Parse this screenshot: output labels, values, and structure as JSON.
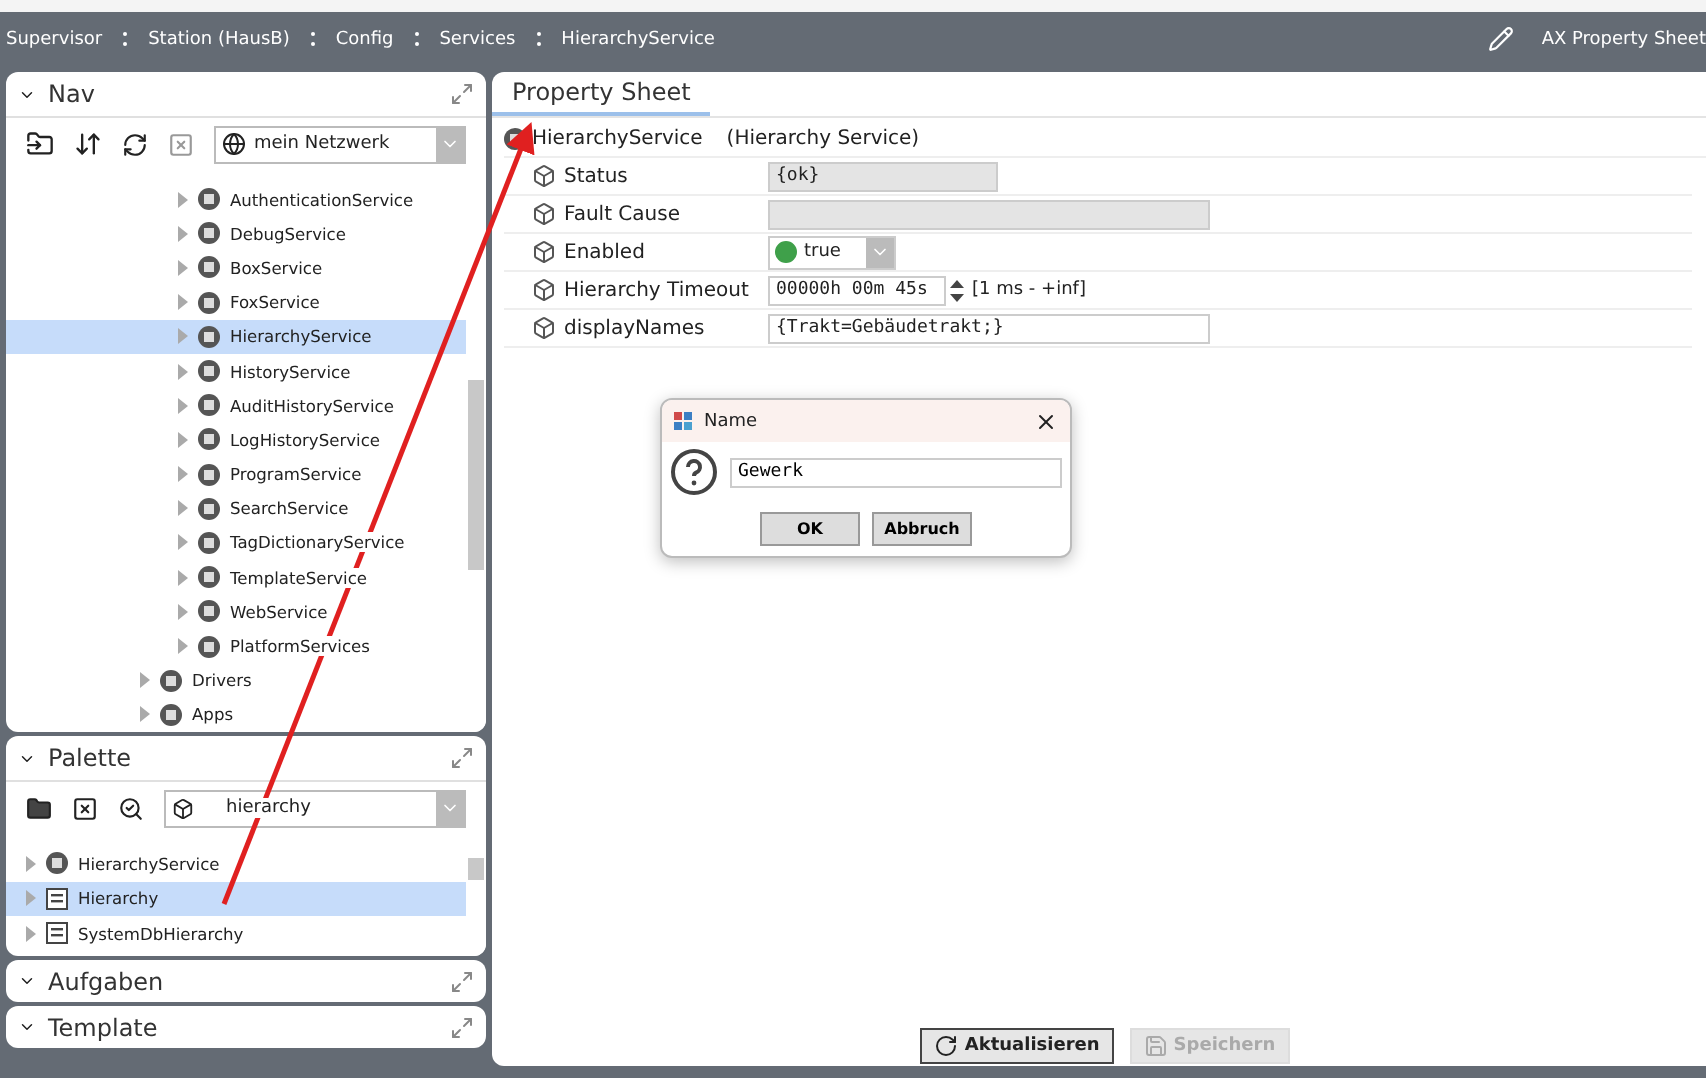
{
  "breadcrumb": [
    "Supervisor",
    "Station (HausB)",
    "Config",
    "Services",
    "HierarchyService"
  ],
  "view_name": "AX Property Sheet",
  "nav": {
    "title": "Nav",
    "network": "mein Netzwerk",
    "service_items": [
      {
        "label": "AuthenticationService",
        "selected": false
      },
      {
        "label": "DebugService",
        "selected": false
      },
      {
        "label": "BoxService",
        "selected": false
      },
      {
        "label": "FoxService",
        "selected": false
      },
      {
        "label": "HierarchyService",
        "selected": true
      },
      {
        "label": "HistoryService",
        "selected": false
      },
      {
        "label": "AuditHistoryService",
        "selected": false
      },
      {
        "label": "LogHistoryService",
        "selected": false
      },
      {
        "label": "ProgramService",
        "selected": false
      },
      {
        "label": "SearchService",
        "selected": false
      },
      {
        "label": "TagDictionaryService",
        "selected": false
      },
      {
        "label": "TemplateService",
        "selected": false
      },
      {
        "label": "WebService",
        "selected": false
      },
      {
        "label": "PlatformServices",
        "selected": false
      }
    ],
    "top_items": [
      {
        "label": "Drivers",
        "selected": false
      },
      {
        "label": "Apps",
        "selected": false
      }
    ]
  },
  "palette": {
    "title": "Palette",
    "filter": "hierarchy",
    "items": [
      {
        "label": "HierarchyService",
        "selected": false
      },
      {
        "label": "Hierarchy",
        "selected": true
      },
      {
        "label": "SystemDbHierarchy",
        "selected": false
      }
    ]
  },
  "collapsed_panels": [
    "Aufgaben",
    "Template"
  ],
  "tabs": [
    {
      "label": "Property Sheet",
      "selected": true
    }
  ],
  "sheet": {
    "component": "HierarchyService",
    "type": "(Hierarchy Service)",
    "properties": [
      {
        "name": "Status",
        "kind": "readonly",
        "value": "{ok}"
      },
      {
        "name": "Fault Cause",
        "kind": "readonly_wide"
      },
      {
        "name": "Enabled",
        "kind": "boolean",
        "value": "true"
      },
      {
        "name": "Hierarchy Timeout",
        "kind": "duration",
        "value": "00000h 00m 45s",
        "range": "[1 ms - +inf]"
      },
      {
        "name": "displayNames",
        "kind": "text",
        "value": "{Trakt=Gebäudetrakt;}"
      }
    ]
  },
  "dialog": {
    "title": "Name",
    "value": "Gewerk",
    "buttons": [
      "OK",
      "Abbruch"
    ]
  },
  "actions": [
    {
      "label": "Aktualisieren",
      "disabled": false
    },
    {
      "label": "Speichern",
      "disabled": true
    }
  ]
}
